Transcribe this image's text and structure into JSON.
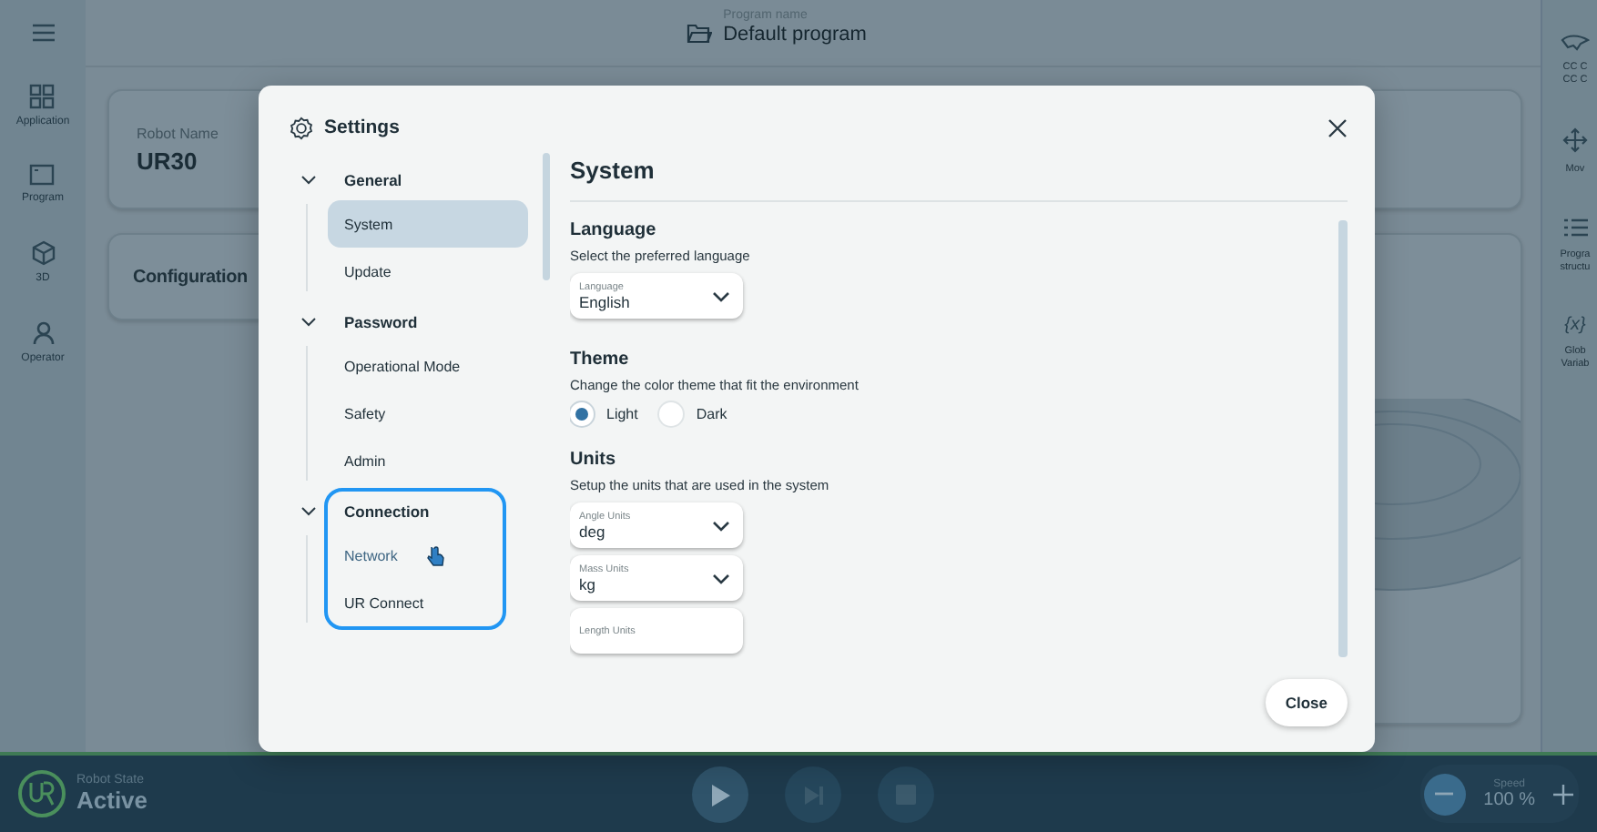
{
  "top_bar": {
    "program_label": "Program name",
    "program_name": "Default program"
  },
  "left_rail": [
    {
      "label": "Application"
    },
    {
      "label": "Program"
    },
    {
      "label": "3D"
    },
    {
      "label": "Operator"
    }
  ],
  "background": {
    "robot_name_label": "Robot Name",
    "robot_name": "UR30",
    "configuration_title": "Configuration"
  },
  "right_rail": [
    {
      "lines": [
        "CC C",
        "CC C"
      ]
    },
    {
      "lines": [
        "Mov"
      ]
    },
    {
      "lines": [
        "Progra",
        "structu"
      ]
    },
    {
      "lines": [
        "Glob",
        "Variab"
      ],
      "icon_text": "{x}"
    }
  ],
  "dialog": {
    "title": "Settings",
    "nav": [
      {
        "label": "General",
        "expanded": true,
        "focused": false,
        "children": [
          {
            "label": "System",
            "selected": true,
            "hovered": false
          },
          {
            "label": "Update",
            "selected": false,
            "hovered": false
          }
        ]
      },
      {
        "label": "Password",
        "expanded": true,
        "focused": false,
        "children": [
          {
            "label": "Operational Mode",
            "selected": false,
            "hovered": false
          },
          {
            "label": "Safety",
            "selected": false,
            "hovered": false
          },
          {
            "label": "Admin",
            "selected": false,
            "hovered": false
          }
        ]
      },
      {
        "label": "Connection",
        "expanded": true,
        "focused": true,
        "children": [
          {
            "label": "Network",
            "selected": false,
            "hovered": true
          },
          {
            "label": "UR Connect",
            "selected": false,
            "hovered": false
          }
        ]
      }
    ],
    "page_title": "System",
    "sections": [
      {
        "kind": "selects",
        "heading": "Language",
        "description": "Select the preferred language",
        "fields": [
          {
            "label": "Language",
            "value": "English"
          }
        ]
      },
      {
        "kind": "radios",
        "heading": "Theme",
        "description": "Change the color theme that fit the environment",
        "options": [
          {
            "label": "Light",
            "selected": true
          },
          {
            "label": "Dark",
            "selected": false
          }
        ]
      },
      {
        "kind": "selects",
        "heading": "Units",
        "description": "Setup the units that are used in the system",
        "fields": [
          {
            "label": "Angle Units",
            "value": "deg"
          },
          {
            "label": "Mass Units",
            "value": "kg"
          },
          {
            "label": "Length Units"
          }
        ]
      }
    ],
    "close_button": "Close"
  },
  "status_bar": {
    "state_label": "Robot State",
    "state": "Active",
    "controls": [
      {
        "kind": "play",
        "disabled": false
      },
      {
        "kind": "step",
        "disabled": true
      },
      {
        "kind": "stop",
        "disabled": true
      }
    ],
    "speed_label": "Speed",
    "speed": "100 %"
  }
}
